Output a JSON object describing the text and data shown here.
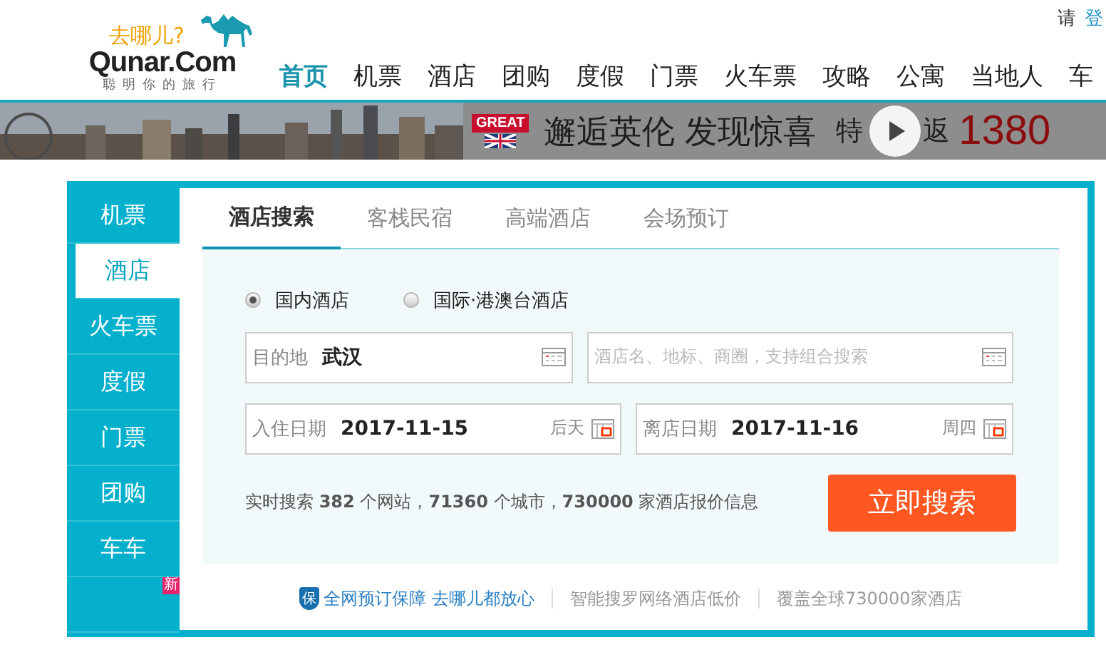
{
  "header": {
    "logo": {
      "slogan": "去哪儿?",
      "brand": "Qunar.Com",
      "tagline": "聪明你的旅行"
    },
    "login": {
      "prompt": "请",
      "link": "登"
    },
    "nav": [
      {
        "label": "首页",
        "selected": true
      },
      {
        "label": "机票",
        "selected": false
      },
      {
        "label": "酒店",
        "selected": false
      },
      {
        "label": "团购",
        "selected": false
      },
      {
        "label": "度假",
        "selected": false
      },
      {
        "label": "门票",
        "selected": false
      },
      {
        "label": "火车票",
        "selected": false
      },
      {
        "label": "攻略",
        "selected": false
      },
      {
        "label": "公寓",
        "selected": false
      },
      {
        "label": "当地人",
        "selected": false
      },
      {
        "label": "车",
        "selected": false
      }
    ]
  },
  "banner": {
    "badge": "GREAT",
    "headline": "邂逅英伦 发现惊喜",
    "offer_start": "特",
    "offer_end": "返",
    "price": "1380"
  },
  "sidebar": [
    {
      "label": "机票",
      "selected": false
    },
    {
      "label": "酒店",
      "selected": true
    },
    {
      "label": "火车票",
      "selected": false
    },
    {
      "label": "度假",
      "selected": false
    },
    {
      "label": "门票",
      "selected": false
    },
    {
      "label": "团购",
      "selected": false
    },
    {
      "label": "车车",
      "selected": false
    },
    {
      "badge": "新",
      "selected": false
    }
  ],
  "tabs": [
    {
      "label": "酒店搜索",
      "selected": true
    },
    {
      "label": "客栈民宿",
      "selected": false
    },
    {
      "label": "高端酒店",
      "selected": false
    },
    {
      "label": "会场预订",
      "selected": false
    }
  ],
  "scope": [
    {
      "label": "国内酒店",
      "selected": true
    },
    {
      "label": "国际·港澳台酒店",
      "selected": false
    }
  ],
  "fields": [
    [
      {
        "label": "目的地",
        "value": "武汉"
      },
      {
        "placeholder": "酒店名、地标、商圈，支持组合搜索"
      }
    ],
    [
      {
        "label": "入住日期",
        "value": "2017-11-15",
        "note": "后天"
      },
      {
        "label": "离店日期",
        "value": "2017-11-16",
        "note": "周四"
      }
    ]
  ],
  "stats": "实时搜索 **382** 个网站，**71360** 个城市，**730000** 家酒店报价信息",
  "search_button": "立即搜索",
  "footer": [
    {
      "kind": "guarantee",
      "icon_text": "保",
      "text": "全网预订保障 去哪儿都放心"
    },
    {
      "kind": "plain",
      "text": "智能搜罗网络酒店低价"
    },
    {
      "kind": "plain",
      "text": "覆盖全球730000家酒店"
    }
  ]
}
